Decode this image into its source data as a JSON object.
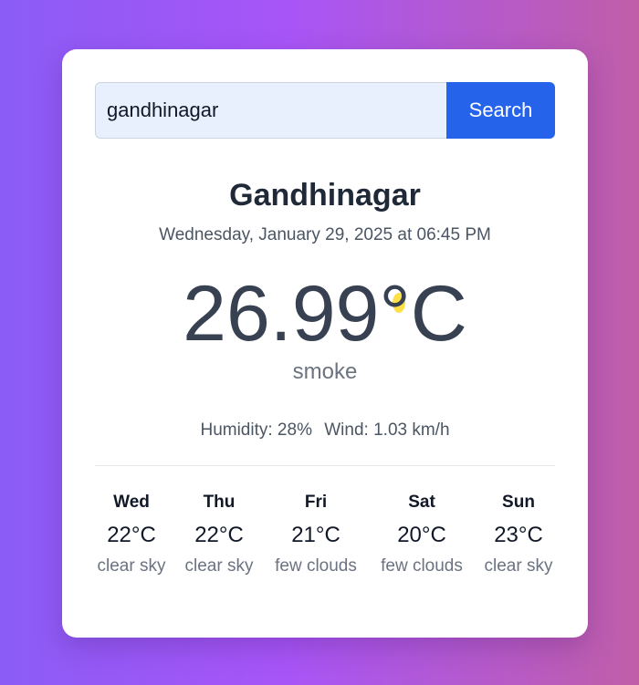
{
  "search": {
    "value": "gandhinagar",
    "button_label": "Search"
  },
  "weather": {
    "city": "Gandhinagar",
    "datetime": "Wednesday, January 29, 2025 at 06:45 PM",
    "temperature": "26.99°C",
    "description": "smoke",
    "humidity": "Humidity: 28%",
    "wind": "Wind: 1.03 km/h"
  },
  "forecast": [
    {
      "day": "Wed",
      "temp": "22°C",
      "desc": "clear sky"
    },
    {
      "day": "Thu",
      "temp": "22°C",
      "desc": "clear sky"
    },
    {
      "day": "Fri",
      "temp": "21°C",
      "desc": "few clouds"
    },
    {
      "day": "Sat",
      "temp": "20°C",
      "desc": "few clouds"
    },
    {
      "day": "Sun",
      "temp": "23°C",
      "desc": "clear sky"
    }
  ],
  "colors": {
    "accent": "#2563eb",
    "background_start": "#8b5cf6",
    "background_end": "#c05ea8"
  }
}
